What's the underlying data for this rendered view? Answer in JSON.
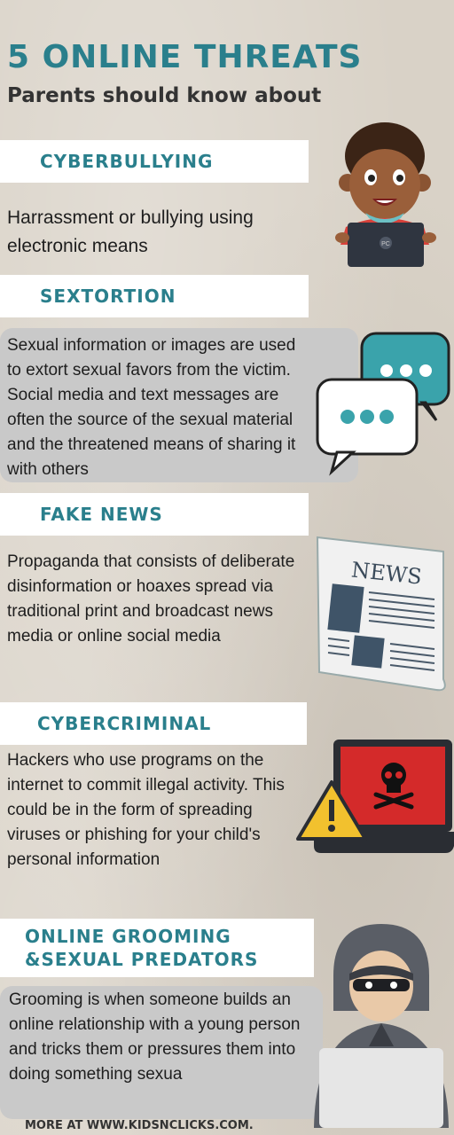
{
  "header": {
    "title": "5 ONLINE THREATS",
    "subtitle": "Parents should know about"
  },
  "sections": [
    {
      "heading": "CYBERBULLYING",
      "body": "Harrassment or bullying using electronic means",
      "icon": "boy-with-laptop-icon"
    },
    {
      "heading": "SEXTORTION",
      "body": " Sexual information or images are used to extort sexual favors from the victim. Social media and text messages are often the source of the sexual material and the threatened means of sharing it with others",
      "icon": "chat-bubbles-icon"
    },
    {
      "heading": "FAKE NEWS",
      "body": "Propaganda that consists of deliberate disinformation or hoaxes spread via traditional print and broadcast news media or online social media",
      "icon": "newspaper-icon"
    },
    {
      "heading": "CYBERCRIMINAL",
      "body": "Hackers who use programs on the internet to commit illegal activity. This could be in the form of spreading viruses or phishing for your child's personal information",
      "icon": "hacked-laptop-icon"
    },
    {
      "heading_line1": "ONLINE GROOMING",
      "heading_line2": "&SEXUAL PREDATORS",
      "body": "Grooming is when someone builds an online relationship with a young person and tricks them or pressures them into doing something sexua",
      "icon": "hooded-hacker-icon"
    }
  ],
  "icons": {
    "laptop_label": "PC",
    "newspaper_label": "NEWS"
  },
  "footer": {
    "text": "MORE AT WWW.KIDSNCLICKS.COM."
  },
  "colors": {
    "accent": "#2a7f8c",
    "background": "#d9d2c7",
    "band": "#ffffff",
    "box": "#c9c9c9"
  }
}
